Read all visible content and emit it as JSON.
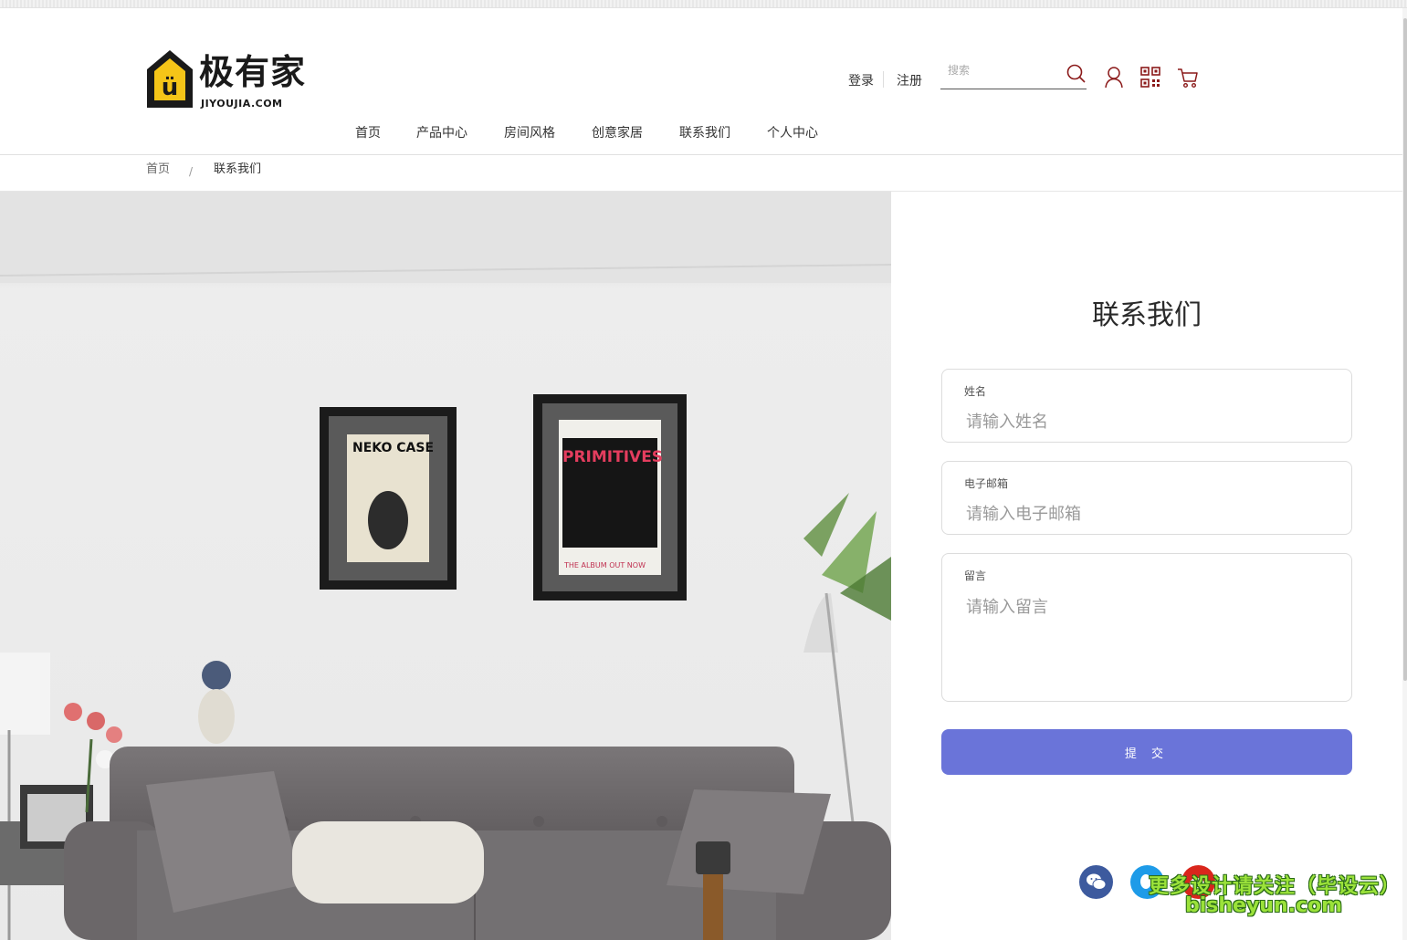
{
  "brand": {
    "name_cn": "极有家",
    "name_en": "JIYOUJIA.COM"
  },
  "header": {
    "login_label": "登录",
    "register_label": "注册",
    "search_placeholder": "搜索"
  },
  "nav": [
    {
      "label": "首页"
    },
    {
      "label": "产品中心"
    },
    {
      "label": "房间风格"
    },
    {
      "label": "创意家居"
    },
    {
      "label": "联系我们"
    },
    {
      "label": "个人中心"
    }
  ],
  "breadcrumb": {
    "home": "首页",
    "separator": "/",
    "current": "联系我们"
  },
  "contact_form": {
    "title": "联系我们",
    "name": {
      "label": "姓名",
      "placeholder": "请输入姓名"
    },
    "email": {
      "label": "电子邮箱",
      "placeholder": "请输入电子邮箱"
    },
    "message": {
      "label": "留言",
      "placeholder": "请输入留言"
    },
    "submit_label": "提 交"
  },
  "watermark": {
    "line1": "更多设计请关注（毕设云）",
    "line2": "bisheyun.com"
  },
  "colors": {
    "accent": "#6a74d9",
    "icon": "#8b1a1a",
    "logo_yellow": "#f5c518"
  }
}
